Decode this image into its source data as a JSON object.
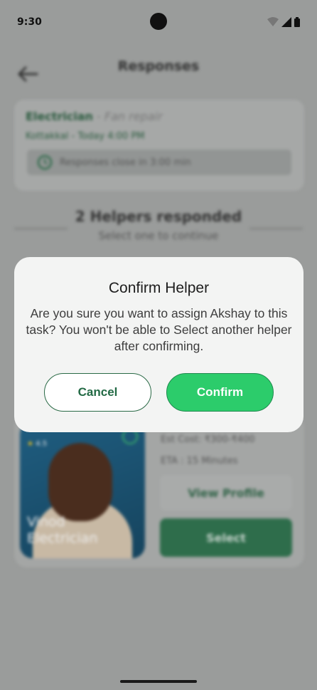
{
  "status_bar": {
    "time": "9:30"
  },
  "header": {
    "title": "Responses"
  },
  "job": {
    "category": "Electrician",
    "separator": " - ",
    "task": "Fan repair",
    "location_time": "Kottakkal - Today 4:00 PM",
    "closing_note": "Responses close in 3:00 min"
  },
  "responses": {
    "title": "2 Helpers responded",
    "subtitle": "Select one to continue"
  },
  "helper": {
    "rating": "4.5",
    "name_line1": "Vinod",
    "name_line2": "Electrician",
    "est_cost": "Est Cost: ₹300-₹400",
    "eta": "ETA : 15 Minutes",
    "view_profile_label": "View Profile",
    "select_label": "Select"
  },
  "modal": {
    "title": "Confirm Helper",
    "message": "Are you sure you want to assign Akshay to this task? You won't be able to Select another helper after confirming.",
    "cancel_label": "Cancel",
    "confirm_label": "Confirm"
  },
  "colors": {
    "primary_green": "#2ccc6b",
    "dark_green": "#236a45",
    "overlay": "#9a9c9b",
    "modal_bg": "#f3f4f3"
  }
}
